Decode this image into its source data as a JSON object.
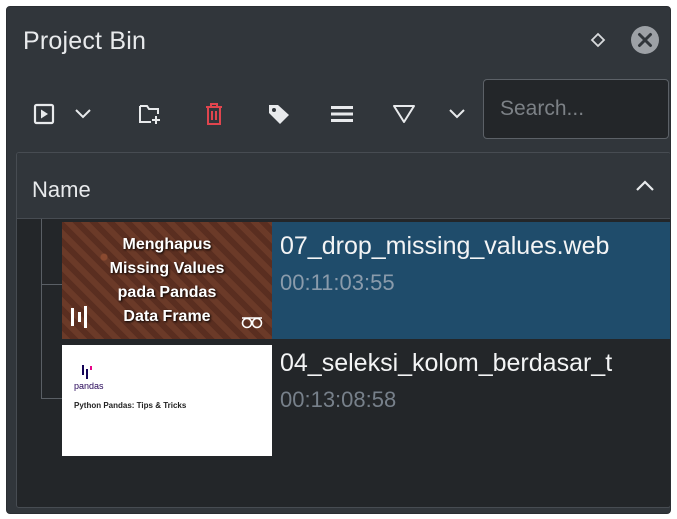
{
  "panel": {
    "title": "Project Bin"
  },
  "toolbar": {
    "search_placeholder": "Search...",
    "delete_color": "#e0454e"
  },
  "view": {
    "column_header": "Name"
  },
  "clips": [
    {
      "name": "07_drop_missing_values.web",
      "duration": "00:11:03:55",
      "selected": true,
      "thumb_lines": [
        "Menghapus",
        "Missing Values",
        "pada Pandas",
        "Data Frame"
      ]
    },
    {
      "name": "04_seleksi_kolom_berdasar_t",
      "duration": "00:13:08:58",
      "selected": false,
      "thumb_brand": "pandas",
      "thumb_heading": "Python Pandas: Tips & Tricks"
    }
  ],
  "colors": {
    "panel_bg": "#31363b",
    "view_bg": "#232629",
    "selection": "#1f4c6b",
    "text": "#e8eaec",
    "muted_text": "#77808a"
  },
  "icons": {
    "float": "diamond-icon",
    "close": "close-icon",
    "add_clip": "add-clip-icon",
    "add_folder": "add-folder-icon",
    "delete": "trash-icon",
    "tag": "tag-icon",
    "menu": "hamburger-icon",
    "filter": "filter-icon"
  }
}
